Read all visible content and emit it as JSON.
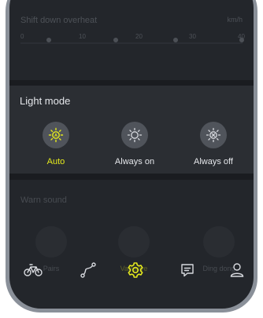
{
  "background_panel": {
    "title": "Shift down overheat",
    "unit": "km/h",
    "ticks": [
      "0",
      "10",
      "20",
      "30",
      "40"
    ]
  },
  "light_mode": {
    "title": "Light mode",
    "selected": "Auto",
    "options": [
      {
        "label": "Auto",
        "icon": "sun-auto-icon",
        "active": true
      },
      {
        "label": "Always on",
        "icon": "sun-icon",
        "active": false
      },
      {
        "label": "Always off",
        "icon": "sun-off-icon",
        "active": false
      }
    ]
  },
  "background_lower": {
    "title": "Warn sound",
    "items": [
      "Pairs",
      "Varidrive",
      "Ding dong"
    ]
  },
  "tabbar": {
    "tabs": [
      {
        "icon": "bike-icon",
        "active": false
      },
      {
        "icon": "route-icon",
        "active": false
      },
      {
        "icon": "settings-gear-icon",
        "active": true
      },
      {
        "icon": "chat-icon",
        "active": false
      },
      {
        "icon": "user-icon",
        "active": false
      }
    ]
  },
  "colors": {
    "accent": "#e5ea1d",
    "screen_bg": "#23262b",
    "card_bg": "#2b2e33",
    "text": "#e4e6ea"
  }
}
